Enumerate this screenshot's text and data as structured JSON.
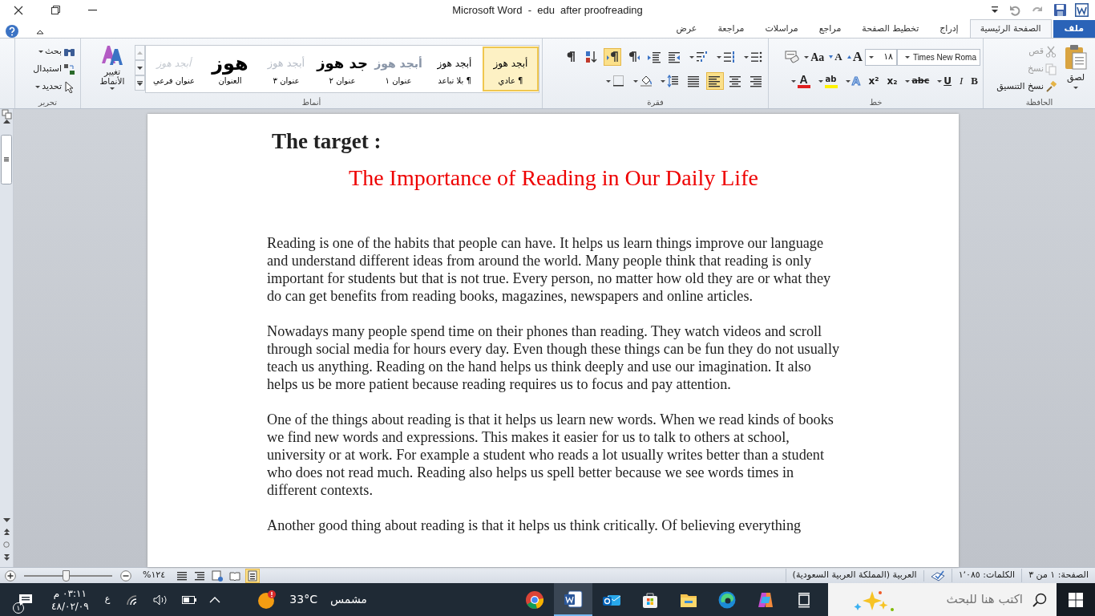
{
  "window": {
    "title": "Microsoft Word  -  edu  after proofreading"
  },
  "tabs": [
    {
      "label": "ملف",
      "kind": "file",
      "selected": false
    },
    {
      "label": "الصفحة الرئيسية",
      "kind": "tab",
      "selected": true
    },
    {
      "label": "إدراج",
      "kind": "tab",
      "selected": false
    },
    {
      "label": "تخطيط الصفحة",
      "kind": "tab",
      "selected": false
    },
    {
      "label": "مراجع",
      "kind": "tab",
      "selected": false
    },
    {
      "label": "مراسلات",
      "kind": "tab",
      "selected": false
    },
    {
      "label": "مراجعة",
      "kind": "tab",
      "selected": false
    },
    {
      "label": "عرض",
      "kind": "tab",
      "selected": false
    }
  ],
  "clipboard": {
    "label": "الحافظة",
    "paste": "لصق",
    "items": [
      {
        "label": "قص",
        "kind": "cut",
        "disabled": true
      },
      {
        "label": "نسخ",
        "kind": "copy",
        "disabled": true
      },
      {
        "label": "نسخ التنسيق",
        "kind": "painter",
        "disabled": false
      }
    ]
  },
  "font": {
    "label": "خط",
    "name": "Times New Roma",
    "size": "١٨",
    "grow": "A",
    "shrink": "A",
    "case": "Aa",
    "format_buttons": [
      {
        "text": "B",
        "kind": "bold"
      },
      {
        "text": "I",
        "kind": "italic"
      },
      {
        "text": "U",
        "kind": "underline"
      },
      {
        "text": "abc",
        "kind": "strike"
      },
      {
        "text": "x₂",
        "kind": "sub"
      },
      {
        "text": "x²",
        "kind": "sup"
      }
    ],
    "effects": "A",
    "highlight": "ab",
    "font_color_letter": "A"
  },
  "paragraph": {
    "label": "فقرة",
    "row1": [
      {
        "kind": "bullets",
        "pressed": false
      },
      {
        "kind": "numbering",
        "pressed": false
      },
      {
        "kind": "multilevel",
        "pressed": false
      },
      {
        "kind": "outdent",
        "pressed": false
      },
      {
        "kind": "indent",
        "pressed": false
      },
      {
        "kind": "rtl",
        "pressed": false
      },
      {
        "kind": "ltr",
        "pressed": true
      },
      {
        "kind": "sort",
        "pressed": false
      },
      {
        "kind": "marks",
        "pressed": false
      }
    ],
    "row2": [
      {
        "kind": "align_right",
        "pressed": false
      },
      {
        "kind": "align_center",
        "pressed": false
      },
      {
        "kind": "align_left",
        "pressed": true
      },
      {
        "kind": "justify",
        "pressed": false
      },
      {
        "kind": "spacing",
        "pressed": false
      },
      {
        "kind": "shading",
        "pressed": false
      },
      {
        "kind": "borders",
        "pressed": false
      }
    ]
  },
  "styles": {
    "label": "أنماط",
    "change_styles": "تغيير الأنماط",
    "items": [
      {
        "preview": "أبجد هوز",
        "label": "¶ عادي",
        "kind": "normal",
        "selected": true
      },
      {
        "preview": "أبجد هوز",
        "label": "¶ بلا تباعد",
        "kind": "plain",
        "selected": false
      },
      {
        "preview": "أبجد هوز",
        "label": "عنوان ١",
        "kind": "heading1",
        "selected": false
      },
      {
        "preview": "جد هوز",
        "label": "عنوان ٢",
        "kind": "heading2",
        "selected": false
      },
      {
        "preview": "أبجد هوز",
        "label": "عنوان ٣",
        "kind": "heading3",
        "selected": false
      },
      {
        "preview": "هوز",
        "label": "العنوان",
        "kind": "title",
        "selected": false
      },
      {
        "preview": "أبجد هوز",
        "label": "عنوان فرعي",
        "kind": "subtitle",
        "selected": false
      }
    ]
  },
  "editing": {
    "label": "تحرير",
    "items": [
      {
        "label": "بحث",
        "kind": "find"
      },
      {
        "label": "استبدال",
        "kind": "replace"
      },
      {
        "label": "تحديد",
        "kind": "select"
      }
    ]
  },
  "document": {
    "heading": "The target :",
    "title": "The Importance of Reading in Our Daily Life",
    "paragraphs": [
      "Reading is one of the habits that people can have. It helps us learn things improve our language and understand different ideas from around the world. Many people think that reading is only important for students but that is not true. Every person, no matter how old they are or what they do can get benefits from reading books, magazines, newspapers and online articles.",
      "Nowadays many people spend time on their phones than reading. They watch videos and scroll through social media for hours every day. Even though these things can be fun they do not usually teach us anything. Reading on the hand helps us think deeply and use our imagination. It also helps us be more patient because reading requires us to focus and pay attention.",
      "One of the things about reading is that it helps us learn new words. When we read kinds of books we find new words and expressions. This makes it easier for us to talk to others at school, university or at work. For example a student who reads a lot usually writes better than a student who does not read much. Reading also helps us spell better because we see words times in different contexts.",
      "Another good thing about reading is that it helps us think critically. Of believing everything"
    ]
  },
  "status_bar": {
    "page": "الصفحة: ١ من ٣",
    "words": "الكلمات: ١٬٠٨٥",
    "language": "العربية (المملكة العربية السعودية)",
    "zoom": "%١٢٤",
    "zoom_slider": {
      "level": 0.47
    },
    "views": [
      {
        "kind": "print",
        "selected": true
      },
      {
        "kind": "reading",
        "selected": false
      },
      {
        "kind": "web",
        "selected": false
      },
      {
        "kind": "outline",
        "selected": false
      },
      {
        "kind": "draft",
        "selected": false
      }
    ]
  },
  "taskbar": {
    "search_placeholder": "اكتب هنا للبحث",
    "apps": [
      {
        "kind": "taskview",
        "selected": false
      },
      {
        "kind": "copilot",
        "selected": false
      },
      {
        "kind": "edge",
        "selected": false
      },
      {
        "kind": "explorer",
        "selected": false
      },
      {
        "kind": "store",
        "selected": false
      },
      {
        "kind": "outlook",
        "selected": false
      },
      {
        "kind": "word",
        "selected": true
      },
      {
        "kind": "chrome",
        "selected": false
      }
    ],
    "weather": {
      "condition": "مشمس",
      "temperature": "33°C"
    },
    "keyboard": "ع",
    "time": "٠٣:١١ م",
    "date": "٤٨/٠٢/٠٩",
    "notifications": "١"
  }
}
